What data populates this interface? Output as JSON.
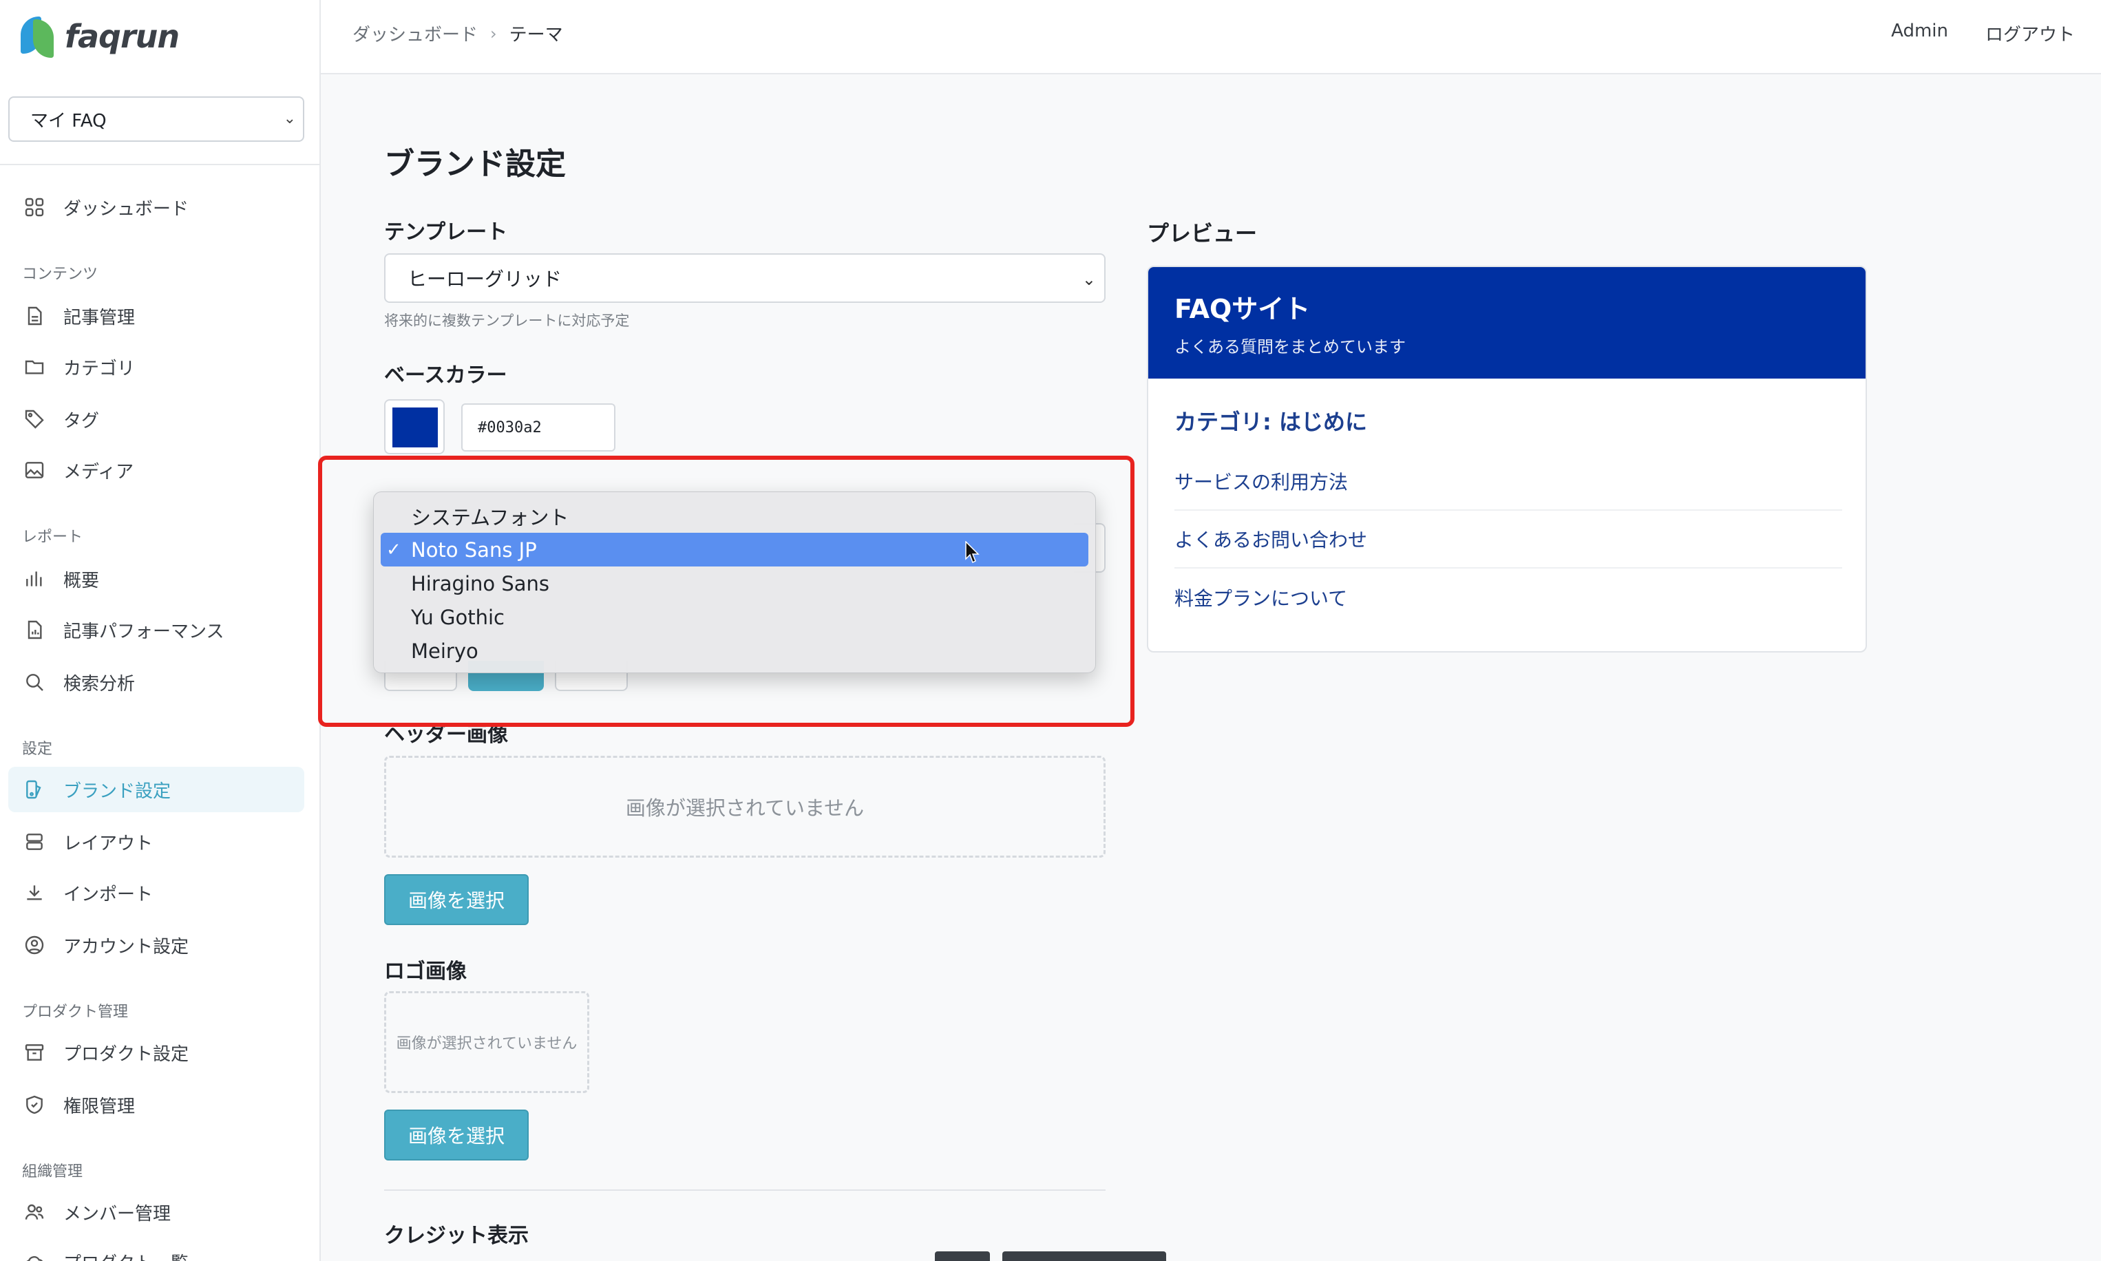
{
  "app": {
    "logo_text": "faqrun"
  },
  "sidebar": {
    "faq_selector": "マイ FAQ",
    "dashboard": "ダッシュボード",
    "sections": [
      {
        "label": "コンテンツ",
        "items": [
          "記事管理",
          "カテゴリ",
          "タグ",
          "メディア"
        ]
      },
      {
        "label": "レポート",
        "items": [
          "概要",
          "記事パフォーマンス",
          "検索分析"
        ]
      },
      {
        "label": "設定",
        "items": [
          "ブランド設定",
          "レイアウト",
          "インポート",
          "アカウント設定"
        ]
      },
      {
        "label": "プロダクト管理",
        "items": [
          "プロダクト設定",
          "権限管理"
        ]
      },
      {
        "label": "組織管理",
        "items": [
          "メンバー管理",
          "プロダクト一覧"
        ]
      }
    ],
    "active_item": "ブランド設定"
  },
  "header": {
    "breadcrumb": [
      "ダッシュボード",
      "テーマ"
    ],
    "user": "Admin",
    "logout": "ログアウト"
  },
  "main": {
    "title": "ブランド設定",
    "template": {
      "label": "テンプレート",
      "value": "ヒーローグリッド",
      "helper": "将来的に複数テンプレートに対応予定"
    },
    "base_color": {
      "label": "ベースカラー",
      "hex": "#0030a2",
      "color": "#0030a2"
    },
    "font": {
      "options": [
        "システムフォント",
        "Noto Sans JP",
        "Hiragino Sans",
        "Yu Gothic",
        "Meiryo"
      ],
      "selected": "Noto Sans JP",
      "check": "✓"
    },
    "header_image": {
      "label": "ヘッダー画像",
      "empty": "画像が選択されていません",
      "button": "画像を選択"
    },
    "logo_image": {
      "label": "ロゴ画像",
      "empty": "画像が選択されていません",
      "button": "画像を選択"
    },
    "credit": {
      "label": "クレジット表示"
    }
  },
  "preview": {
    "label": "プレビュー",
    "site_title": "FAQサイト",
    "site_subtitle": "よくある質問をまとめています",
    "category": "カテゴリ: はじめに",
    "links": [
      "サービスの利用方法",
      "よくあるお問い合わせ",
      "料金プランについて"
    ],
    "hero_color": "#0030a2",
    "text_color": "#1c3f8f"
  },
  "colors": {
    "accent": "#4aaec8",
    "highlight": "#e8231f",
    "selection": "#5a8ff0"
  }
}
